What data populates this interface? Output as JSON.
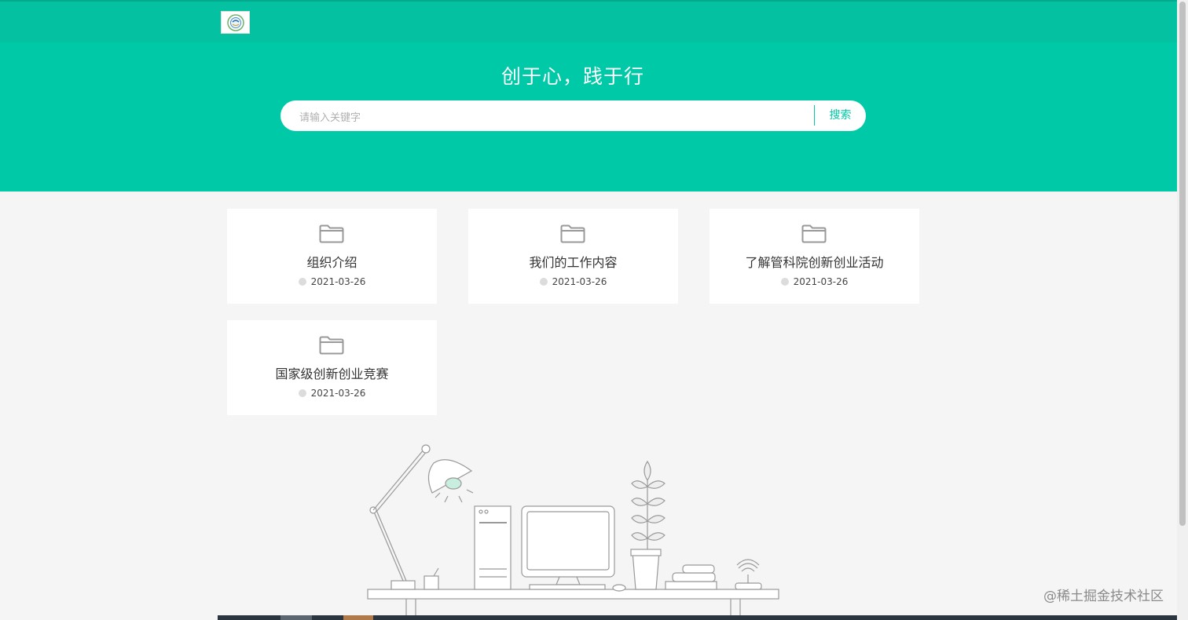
{
  "header": {
    "slogan": "创于心，践于行",
    "logo_icon": "school-emblem-icon"
  },
  "search": {
    "placeholder": "请输入关键字",
    "value": "",
    "button_label": "搜索"
  },
  "cards": [
    {
      "title": "组织介绍",
      "date": "2021-03-26",
      "icon": "folder-icon"
    },
    {
      "title": "我们的工作内容",
      "date": "2021-03-26",
      "icon": "folder-icon"
    },
    {
      "title": "了解管科院创新创业活动",
      "date": "2021-03-26",
      "icon": "folder-icon"
    },
    {
      "title": "国家级创新创业竞赛",
      "date": "2021-03-26",
      "icon": "folder-icon"
    }
  ],
  "watermark": "@稀土掘金技术社区",
  "colors": {
    "accent": "#00c9a7",
    "topbar": "#04c1a1",
    "background": "#f5f5f5"
  }
}
